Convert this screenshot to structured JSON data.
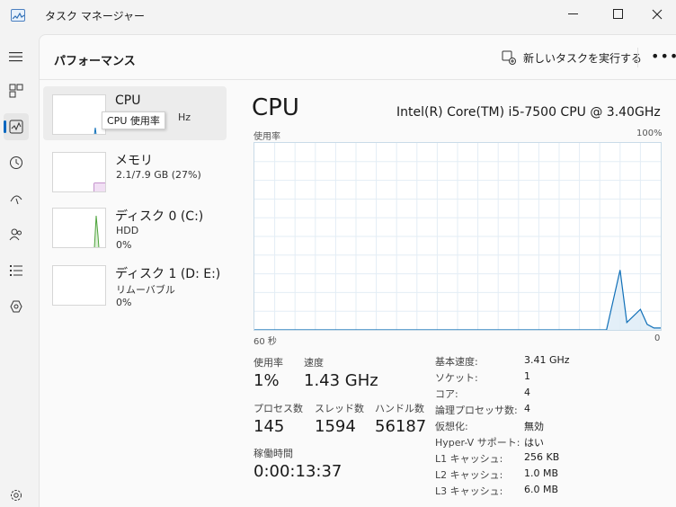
{
  "window": {
    "title": "タスク マネージャー"
  },
  "header": {
    "title": "パフォーマンス",
    "new_task_label": "新しいタスクを実行する",
    "more_label": "•••"
  },
  "devices": [
    {
      "name": "CPU",
      "sub": "Hz",
      "sub2": "",
      "tooltip": "CPU 使用率",
      "color": "#1170b8"
    },
    {
      "name": "メモリ",
      "sub": "2.1/7.9 GB (27%)",
      "sub2": "",
      "color": "#8b2a9b"
    },
    {
      "name": "ディスク 0 (C:)",
      "sub": "HDD",
      "sub2": "0%",
      "color": "#4da33b"
    },
    {
      "name": "ディスク 1 (D: E:)",
      "sub": "リムーバブル",
      "sub2": "0%",
      "color": "#4da33b"
    }
  ],
  "detail": {
    "title": "CPU",
    "model": "Intel(R) Core(TM) i5-7500 CPU @ 3.40GHz",
    "graph_label_left": "使用率",
    "graph_label_right": "100%",
    "graph_axis_left": "60 秒",
    "graph_axis_right": "0",
    "graph_color": "#1170b8"
  },
  "stats": {
    "usage_label": "使用率",
    "usage_value": "1%",
    "speed_label": "速度",
    "speed_value": "1.43 GHz",
    "processes_label": "プロセス数",
    "processes_value": "145",
    "threads_label": "スレッド数",
    "threads_value": "1594",
    "handles_label": "ハンドル数",
    "handles_value": "56187",
    "uptime_label": "稼働時間",
    "uptime_value": "0:00:13:37"
  },
  "specs": [
    {
      "label": "基本速度:",
      "value": "3.41 GHz"
    },
    {
      "label": "ソケット:",
      "value": "1"
    },
    {
      "label": "コア:",
      "value": "4"
    },
    {
      "label": "論理プロセッサ数:",
      "value": "4"
    },
    {
      "label": "仮想化:",
      "value": "無効"
    },
    {
      "label": "Hyper-V サポート:",
      "value": "はい"
    },
    {
      "label": "L1 キャッシュ:",
      "value": "256 KB"
    },
    {
      "label": "L2 キャッシュ:",
      "value": "1.0 MB"
    },
    {
      "label": "L3 キャッシュ:",
      "value": "6.0 MB"
    }
  ],
  "chart_data": {
    "type": "area",
    "title": "",
    "xlabel": "",
    "ylabel": "使用率",
    "ylim": [
      0,
      100
    ],
    "xlim": [
      60,
      0
    ],
    "x": [
      60,
      8,
      6,
      5,
      3,
      2,
      1,
      0
    ],
    "values": [
      0,
      0,
      32,
      4,
      11,
      3,
      1,
      1
    ],
    "grid": true
  },
  "rail_icons": [
    "hamburger-icon",
    "processes-icon",
    "performance-icon",
    "history-icon",
    "startup-icon",
    "users-icon",
    "details-icon",
    "services-icon",
    "settings-icon"
  ]
}
